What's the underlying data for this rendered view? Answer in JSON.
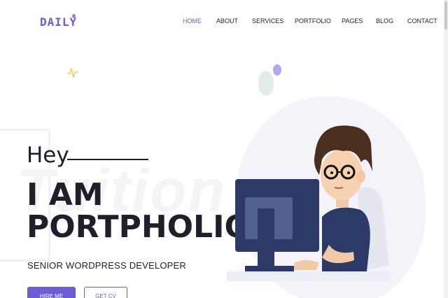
{
  "header": {
    "logo_text": "DAILY",
    "nav": [
      {
        "label": "HOME",
        "active": true
      },
      {
        "label": "ABOUT",
        "active": false
      },
      {
        "label": "SERVICES",
        "active": false
      },
      {
        "label": "PORTFOLIO",
        "active": false
      },
      {
        "label": "PAGES",
        "active": false
      },
      {
        "label": "BLOG",
        "active": false
      },
      {
        "label": "CONTACT",
        "active": false
      }
    ]
  },
  "hero": {
    "greeting": "Hey",
    "title_line1": "I AM",
    "title_line2": "PORTPHOLIO",
    "subtitle": "SENIOR WORDPRESS DEVELOPER",
    "background_word": "Tuition",
    "primary_button": "HIRE ME",
    "secondary_button": "GET CV"
  },
  "icons": {
    "pulse": "pulse-icon",
    "illustration": "developer-illustration"
  },
  "colors": {
    "accent": "#6c5dd3",
    "text": "#1f1f2b",
    "illustration_navy": "#2b3a67",
    "hair": "#4a2e1e"
  }
}
